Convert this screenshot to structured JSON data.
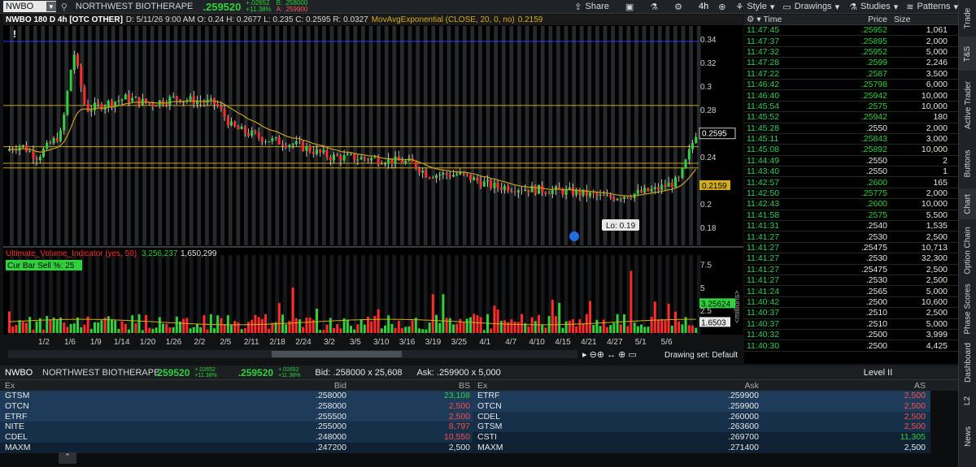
{
  "topbar": {
    "symbol": "NWBO",
    "company": "NORTHWEST BIOTHERAPE",
    "last": ".259520",
    "chg": "+.02652",
    "chg_pct": "+11.38%",
    "bid_lbl": "B: .258000",
    "ask_lbl": "A: .259900",
    "share": "Share",
    "period": "4h",
    "style": "Style",
    "drawings": "Drawings",
    "studies": "Studies",
    "patterns": "Patterns"
  },
  "infobar": {
    "title": "NWBO 180 D 4h [OTC OTHER]",
    "ohlc": "D: 5/11/26 9:00 AM  O: 0.24  H: 0.2677  L: 0.235  C: 0.2595  R: 0.0327",
    "study": "MovAvgExponential (CLOSE, 20, 0, no)",
    "study_val": "0.2159"
  },
  "price_axis": {
    "ticks": [
      "0.34",
      "0.32",
      "0.3",
      "0.28",
      "0.24",
      "0.2",
      "0.18"
    ],
    "last_label": "0.2595",
    "ma_label": "0.2159",
    "lo_label": "Lo: 0.19"
  },
  "volume": {
    "title": "Ultimate_Volume_Indicator (yes, 50)",
    "v1": "3,256,237",
    "v2": "1,650,299",
    "cur_bar": "Cur Bar Sell %: 25",
    "ticks": [
      "7.5",
      "5",
      "2.5"
    ],
    "lbl1": "3.25624",
    "lbl2": "1.6503",
    "unit": "<millions>"
  },
  "date_ticks": [
    "1/2",
    "1/6",
    "1/9",
    "1/14",
    "1/20",
    "1/26",
    "2/2",
    "2/5",
    "2/11",
    "2/18",
    "2/24",
    "3/2",
    "3/5",
    "3/10",
    "3/16",
    "3/19",
    "3/25",
    "4/1",
    "4/7",
    "4/10",
    "4/15",
    "4/21",
    "4/27",
    "5/1",
    "5/6"
  ],
  "drawing_set": "Drawing set: Default",
  "ts": {
    "time_hdr": "Time",
    "price_hdr": "Price",
    "size_hdr": "Size",
    "rows": [
      [
        "11:47:45",
        ".25952",
        "1,061"
      ],
      [
        "11:47:37",
        ".25895",
        "2,000"
      ],
      [
        "11:47:32",
        ".25952",
        "5,000"
      ],
      [
        "11:47:28",
        ".2599",
        "2,246"
      ],
      [
        "11:47:22",
        ".2587",
        "3,500"
      ],
      [
        "11:46:42",
        ".25798",
        "6,000"
      ],
      [
        "11:46:40",
        ".25942",
        "10,000"
      ],
      [
        "11:45:54",
        ".2575",
        "10,000"
      ],
      [
        "11:45:52",
        ".25942",
        "180"
      ],
      [
        "11:45:28",
        ".2550",
        "2,000"
      ],
      [
        "11:45:11",
        ".25843",
        "3,000"
      ],
      [
        "11:45:08",
        ".25892",
        "10,000"
      ],
      [
        "11:44:49",
        ".2550",
        "2"
      ],
      [
        "11:43:40",
        ".2550",
        "1"
      ],
      [
        "11:42:57",
        ".2600",
        "165"
      ],
      [
        "11:42:50",
        ".25775",
        "2,000"
      ],
      [
        "11:42:43",
        ".2600",
        "10,000"
      ],
      [
        "11:41:58",
        ".2575",
        "5,500"
      ],
      [
        "11:41:31",
        ".2540",
        "1,535"
      ],
      [
        "11:41:27",
        ".2530",
        "2,500"
      ],
      [
        "11:41:27",
        ".25475",
        "10,713"
      ],
      [
        "11:41:27",
        ".2530",
        "32,300"
      ],
      [
        "11:41:27",
        ".25475",
        "2,500"
      ],
      [
        "11:41:27",
        ".2530",
        "2,500"
      ],
      [
        "11:41:24",
        ".2565",
        "5,000"
      ],
      [
        "11:40:42",
        ".2500",
        "10,600"
      ],
      [
        "11:40:37",
        ".2510",
        "2,500"
      ],
      [
        "11:40:37",
        ".2510",
        "5,000"
      ],
      [
        "11:40:32",
        ".2500",
        "3,999"
      ],
      [
        "11:40:30",
        ".2500",
        "4,425"
      ]
    ]
  },
  "rightnav": [
    "Trade",
    "T&S",
    "Active Trader",
    "Buttons",
    "Chart",
    "Option Chain",
    "Phase Scores",
    "Dashboard",
    "L2",
    "News"
  ],
  "l2": {
    "symbol": "NWBO",
    "company": "NORTHWEST BIOTHERAPE",
    "last": ".259520",
    "chg": "+.02652",
    "chg_pct": "+11.38%",
    "last2": ".259520",
    "chg2": "+.02652",
    "chg_pct2": "+11.38%",
    "bid": "Bid: .258000 x 25,608",
    "ask": "Ask: .259900 x 5,000",
    "level": "Level II",
    "hdr": {
      "ex": "Ex",
      "bid": "Bid",
      "bs": "BS",
      "ex2": "Ex",
      "ask": "Ask",
      "as": "AS"
    },
    "bids": [
      [
        "GTSM",
        ".258000",
        "23,108"
      ],
      [
        "OTCN",
        ".258000",
        "2,500"
      ],
      [
        "ETRF",
        ".255500",
        "2,500"
      ],
      [
        "NITE",
        ".255000",
        "8,797"
      ],
      [
        "CDEL",
        ".248000",
        "10,550"
      ],
      [
        "MAXM",
        ".247200",
        "2,500"
      ]
    ],
    "asks": [
      [
        "ETRF",
        ".259900",
        "2,500"
      ],
      [
        "OTCN",
        ".259900",
        "2,500"
      ],
      [
        "CDEL",
        ".260000",
        "2,500"
      ],
      [
        "GTSM",
        ".263600",
        "2,500"
      ],
      [
        "CSTI",
        ".269700",
        "11,305"
      ],
      [
        "MAXM",
        ".271400",
        "2,500"
      ]
    ]
  },
  "colors": {
    "up": "#2fd13c",
    "down": "#ff2a2a",
    "ma": "#c8a21a",
    "hline": "#c8a21a"
  }
}
